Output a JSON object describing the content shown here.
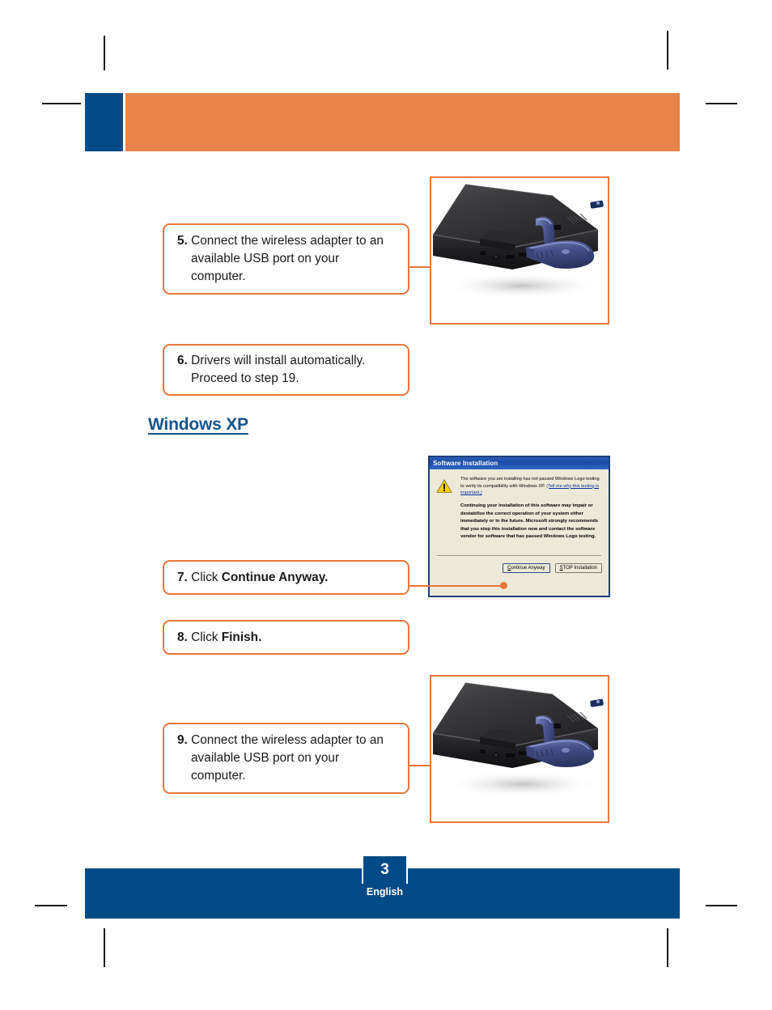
{
  "page": {
    "document_type": "quick-installation-guide",
    "accent_orange": "#E8763C",
    "banner_orange": "#E8834A",
    "brand_blue": "#004B87",
    "heading_blue": "#15548C"
  },
  "header": {
    "banner_label": ""
  },
  "steps": [
    {
      "number": "5.",
      "lines": [
        "Connect the wireless adapter to an",
        "available USB port on your",
        "computer."
      ],
      "bold_tail": ""
    },
    {
      "number": "6.",
      "lines": [
        "Drivers will install automatically.",
        "Proceed to step 19."
      ],
      "bold_tail": ""
    },
    {
      "number": "7.",
      "lead": "Click ",
      "bold_tail": "Continue Anyway."
    },
    {
      "number": "8.",
      "lead": "Click ",
      "bold_tail": "Finish."
    },
    {
      "number": "9.",
      "lines": [
        "Connect the wireless adapter to an",
        "available USB port on your",
        "computer."
      ],
      "bold_tail": ""
    }
  ],
  "section_heading": {
    "label": "Windows XP"
  },
  "dialog": {
    "title": "Software Installation",
    "icon": "warning-triangle-icon",
    "paragraph_1": "The software you are installing has not passed Windows Logo testing to verify its compatibility with Windows XP. ",
    "link_text": "(Tell me why this testing is important.)",
    "paragraph_2": "Continuing your installation of this software may impair or destabilize the correct operation of your system either immediately or in the future. Microsoft strongly recommends that you stop this installation now and contact the software vendor for software that has passed Windows Logo testing.",
    "buttons": [
      {
        "label_prefix": "C",
        "label_rest": "ontinue Anyway",
        "name": "continue-anyway-button",
        "default": true
      },
      {
        "label_prefix": "S",
        "label_rest": "TOP Installation",
        "name": "stop-installation-button",
        "default": false
      }
    ]
  },
  "photos": [
    {
      "name": "laptop-usb-adapter-photo-top",
      "description": "Black laptop viewed from rear-left corner with a blue USB wireless adapter plugged into a side USB port"
    },
    {
      "name": "laptop-usb-adapter-photo-bottom",
      "description": "Black laptop viewed from rear-left corner with a blue USB wireless adapter plugged into a side USB port"
    }
  ],
  "footer": {
    "page_number": "3",
    "language": "English"
  }
}
